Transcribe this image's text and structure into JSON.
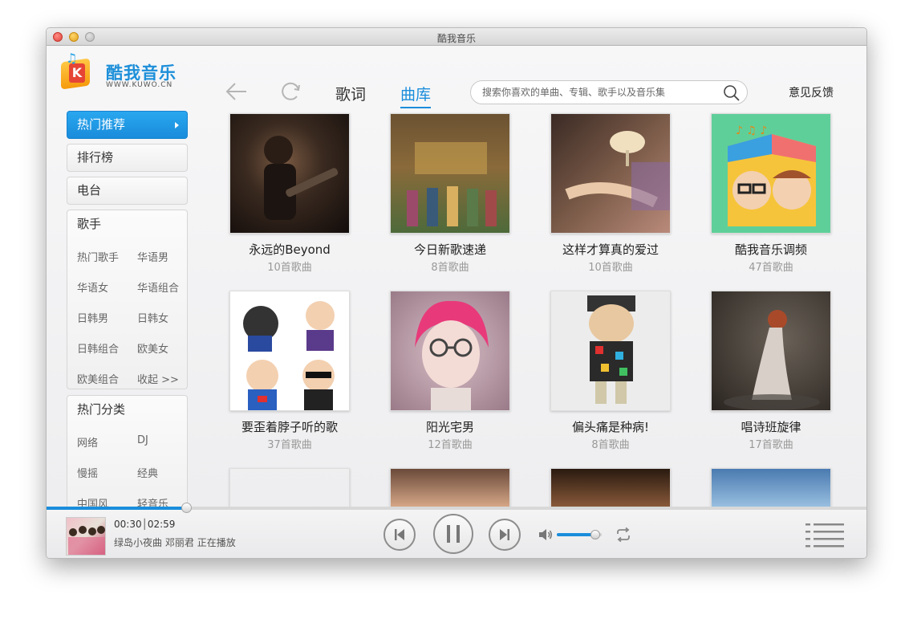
{
  "window": {
    "title": "酷我音乐"
  },
  "logo": {
    "name": "酷我音乐",
    "url": "WWW.KUWO.CN"
  },
  "header": {
    "tabs": [
      {
        "label": "歌词"
      },
      {
        "label": "曲库"
      }
    ],
    "search_placeholder": "搜索你喜欢的单曲、专辑、歌手以及音乐集",
    "feedback_label": "意见反馈"
  },
  "sidebar": {
    "items": [
      {
        "label": "热门推荐"
      },
      {
        "label": "排行榜"
      },
      {
        "label": "电台"
      }
    ],
    "singers": {
      "title": "歌手",
      "links": [
        "热门歌手",
        "华语男",
        "华语女",
        "华语组合",
        "日韩男",
        "日韩女",
        "日韩组合",
        "欧美女",
        "欧美组合",
        "收起 >>"
      ]
    },
    "categories": {
      "title": "热门分类",
      "links": [
        "网络",
        "DJ",
        "慢摇",
        "经典",
        "中国风",
        "轻音乐"
      ]
    }
  },
  "albums": [
    {
      "title": "永远的Beyond",
      "count": "10首歌曲"
    },
    {
      "title": "今日新歌速递",
      "count": "8首歌曲"
    },
    {
      "title": "这样才算真的爱过",
      "count": "10首歌曲"
    },
    {
      "title": "酷我音乐调频",
      "count": "47首歌曲"
    },
    {
      "title": "要歪着脖子听的歌",
      "count": "37首歌曲"
    },
    {
      "title": "阳光宅男",
      "count": "12首歌曲"
    },
    {
      "title": "偏头痛是种病!",
      "count": "8首歌曲"
    },
    {
      "title": "唱诗班旋律",
      "count": "17首歌曲"
    }
  ],
  "player": {
    "current_time": "00:30",
    "total_time": "02:59",
    "track": "绿岛小夜曲",
    "artist": "邓丽君",
    "status": "正在播放",
    "progress": 0.17,
    "volume": 0.85
  },
  "colors": {
    "accent": "#1a8ddb"
  }
}
